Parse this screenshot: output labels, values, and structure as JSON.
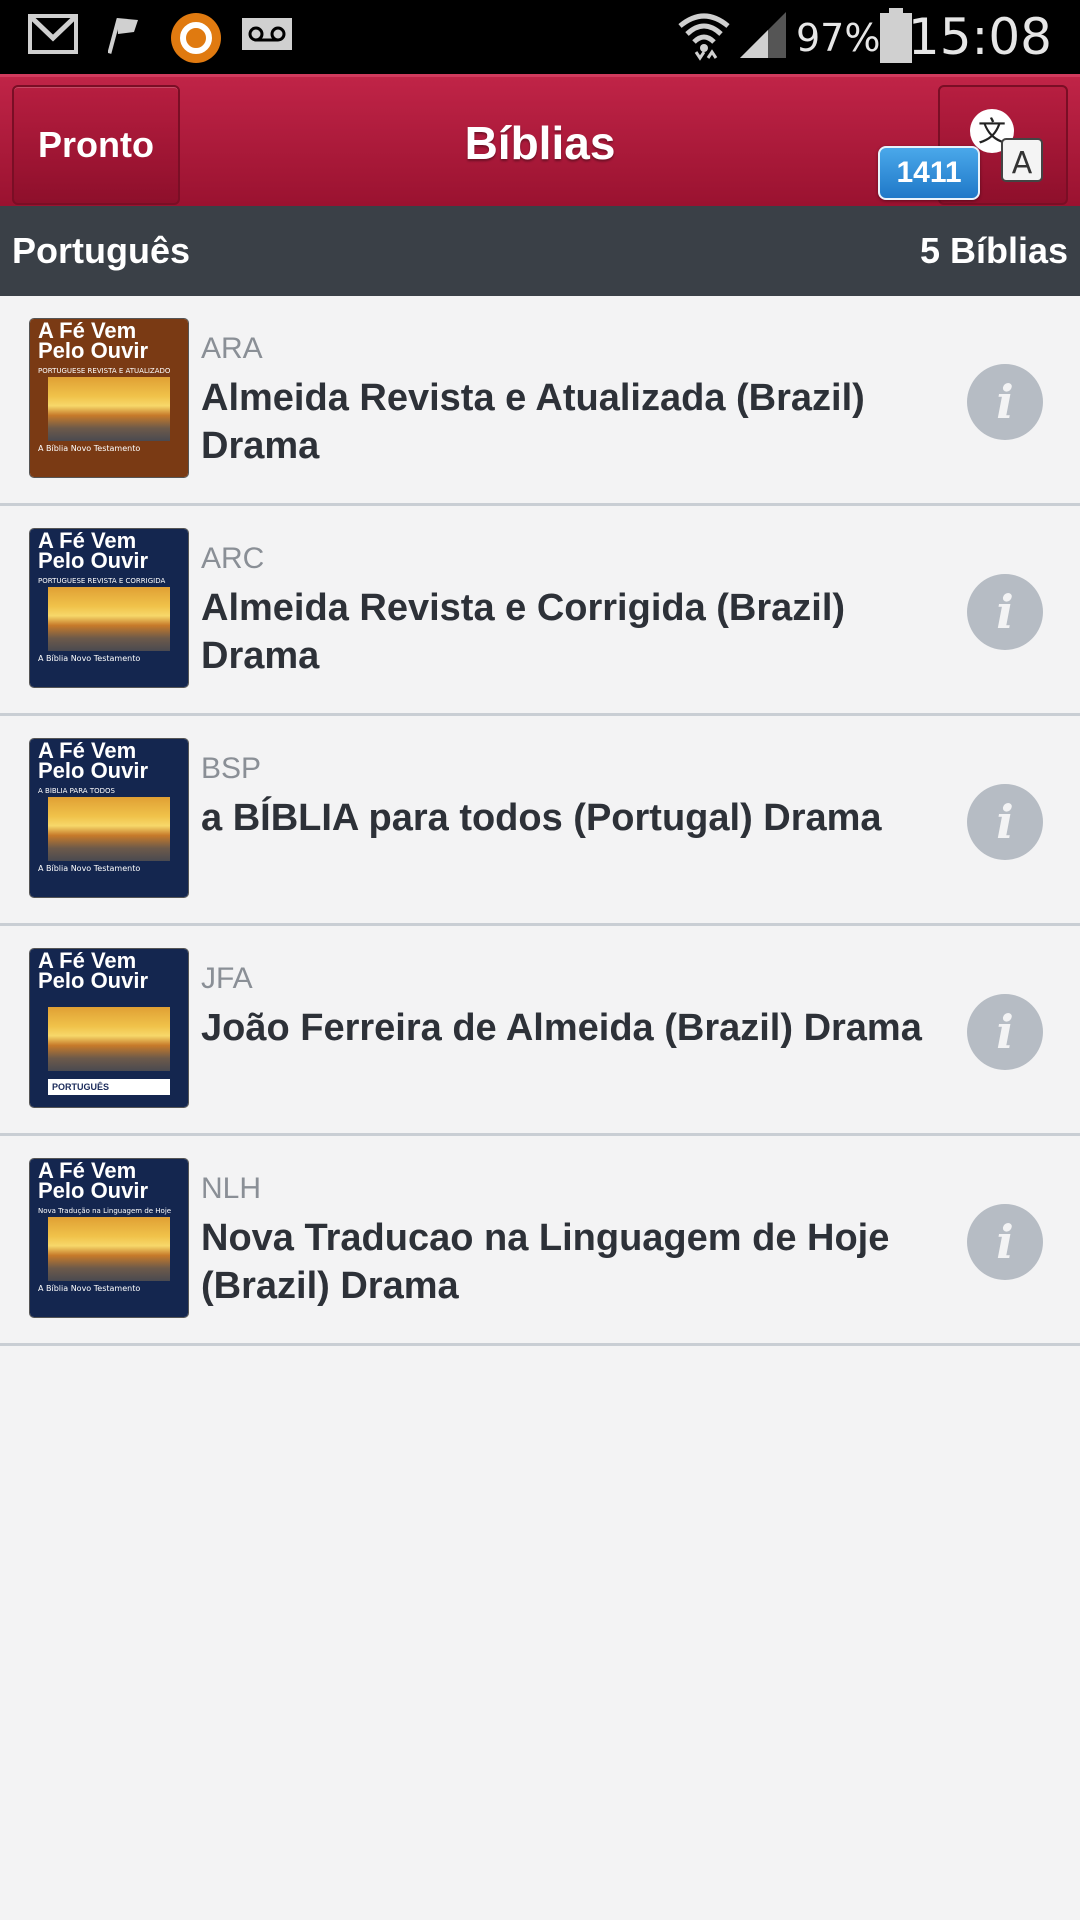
{
  "status_bar": {
    "battery": "97%",
    "time": "15:08",
    "icons": [
      "gmail-icon",
      "flag-icon",
      "avast-icon",
      "voicemail-icon",
      "wifi-icon",
      "signal-icon",
      "battery-icon"
    ]
  },
  "header": {
    "done_label": "Pronto",
    "title": "Bíblias",
    "translate_icon": "translate-icon",
    "badge_count": "1411"
  },
  "section": {
    "language": "Português",
    "count": "5 Bíblias"
  },
  "bibles": [
    {
      "abbr": "ARA",
      "name": "Almeida Revista e Atualizada (Brazil) Drama",
      "cover_title": "A Fé Vem Pelo Ouvir",
      "cover_subtitle": "PORTUGUESE REVISTA E ATUALIZADO",
      "cover_footer": "A Bíblia Novo Testamento",
      "cover_color": "#7a3a14"
    },
    {
      "abbr": "ARC",
      "name": "Almeida Revista e Corrigida (Brazil) Drama",
      "cover_title": "A Fé Vem Pelo Ouvir",
      "cover_subtitle": "PORTUGUESE REVISTA E CORRIGIDA",
      "cover_footer": "A Bíblia Novo Testamento",
      "cover_color": "#14264f"
    },
    {
      "abbr": "BSP",
      "name": "a BÍBLIA para todos (Portugal) Drama",
      "cover_title": "A Fé Vem Pelo Ouvir",
      "cover_subtitle": "A BÍBLIA PARA TODOS",
      "cover_footer": "A Bíblia Novo Testamento",
      "cover_color": "#14264f"
    },
    {
      "abbr": "JFA",
      "name": "João Ferreira de Almeida (Brazil) Drama",
      "cover_title": "A Fé Vem Pelo Ouvir",
      "cover_subtitle": "",
      "cover_footer": "PORTUGUÊS",
      "cover_color": "#14264f"
    },
    {
      "abbr": "NLH",
      "name": "Nova Traducao na Linguagem de Hoje (Brazil) Drama",
      "cover_title": "A Fé Vem Pelo Ouvir",
      "cover_subtitle": "Nova Tradução na Linguagem de Hoje",
      "cover_footer": "A Bíblia Novo Testamento",
      "cover_color": "#14264f"
    }
  ],
  "colors": {
    "header_red": "#b01c3c",
    "section_dark": "#3a4047",
    "badge_blue": "#2f8fdc",
    "info_gray": "#b6bcc4"
  }
}
